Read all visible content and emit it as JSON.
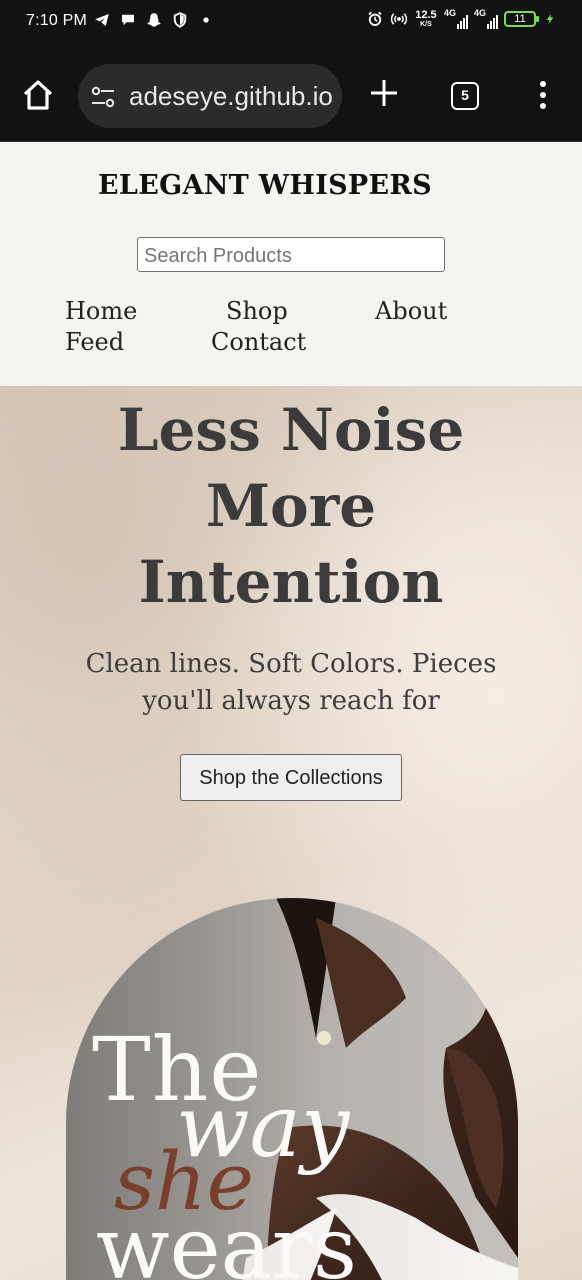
{
  "status_bar": {
    "time": "7:10 PM",
    "left_icons": [
      "telegram-icon",
      "chat-icon",
      "snapchat-icon",
      "shield-icon",
      "dot-icon"
    ],
    "right_icons": [
      "alarm-icon",
      "hotspot-icon",
      "speed-indicator",
      "signal-4g-icon",
      "signal-4g-icon",
      "battery-icon",
      "charging-icon"
    ],
    "net_speed_value": "12.5",
    "net_speed_unit": "K/S",
    "network_1": "4G",
    "network_2": "4G",
    "battery": "11",
    "battery_color": "#7ddc52"
  },
  "browser": {
    "url": "adeseye.github.io",
    "tab_count": "5",
    "icons": [
      "home-icon",
      "tune-icon",
      "plus-icon",
      "tabs-icon",
      "more-vert-icon"
    ]
  },
  "site": {
    "title": "ELEGANT WHISPERS",
    "search_placeholder": "Search Products",
    "nav": {
      "home": "Home",
      "shop": "Shop",
      "about": "About",
      "feed": "Feed",
      "contact": "Contact"
    }
  },
  "hero": {
    "heading_line1": "Less Noise",
    "heading_line2": "More",
    "heading_line3": "Intention",
    "subtitle_line1": "Clean lines. Soft Colors. Pieces",
    "subtitle_line2": "you'll always reach for",
    "cta": "Shop the Collections",
    "image_text": {
      "the": "The",
      "way": "way",
      "she": "she",
      "wears": "wears"
    },
    "accent_color": "#7a3e2c"
  }
}
